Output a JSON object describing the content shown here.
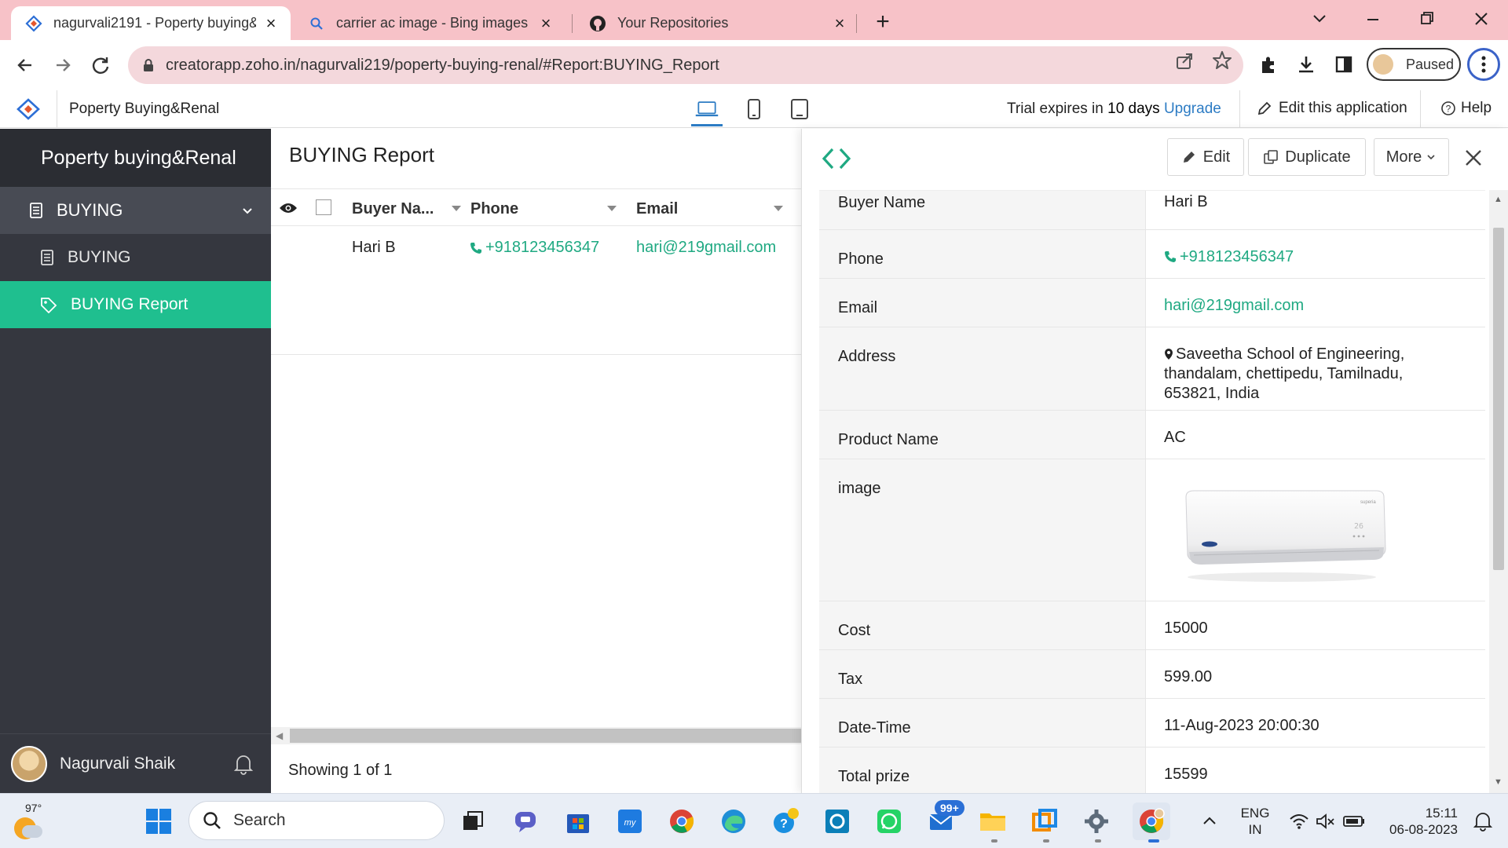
{
  "browser": {
    "tabs": [
      {
        "title": "nagurvali2191 - Poperty buying&",
        "active": true
      },
      {
        "title": "carrier ac image - Bing images",
        "active": false
      },
      {
        "title": "Your Repositories",
        "active": false
      }
    ],
    "url": "creatorapp.zoho.in/nagurvali219/poperty-buying-renal/#Report:BUYING_Report",
    "profile_label": "Paused"
  },
  "app_header": {
    "app_name": "Poperty Buying&Renal",
    "trial_prefix": "Trial expires in",
    "trial_days": "10 days",
    "upgrade": "Upgrade",
    "edit_app": "Edit this application",
    "help": "Help"
  },
  "sidebar": {
    "title": "Poperty buying&Renal",
    "group": "BUYING",
    "items": [
      {
        "label": "BUYING",
        "active": false
      },
      {
        "label": "BUYING Report",
        "active": true
      }
    ],
    "user_name": "Nagurvali Shaik"
  },
  "report": {
    "title": "BUYING Report",
    "columns": [
      "Buyer Na...",
      "Phone",
      "Email"
    ],
    "rows": [
      {
        "buyer": "Hari B",
        "phone": "+918123456347",
        "email": "hari@219gmail.com"
      }
    ],
    "footer_prefix": "Showing",
    "footer_count": "1",
    "footer_of": "of",
    "footer_total": "1"
  },
  "detail": {
    "buttons": {
      "edit": "Edit",
      "duplicate": "Duplicate",
      "more": "More"
    },
    "fields": [
      {
        "key": "Buyer Name",
        "value": "Hari B"
      },
      {
        "key": "Phone",
        "value": "+918123456347"
      },
      {
        "key": "Email",
        "value": "hari@219gmail.com"
      },
      {
        "key": "Address",
        "value_lines": [
          "Saveetha School of Engineering,",
          "thandalam, chettipedu, Tamilnadu,",
          "653821, India"
        ]
      },
      {
        "key": "Product Name",
        "value": "AC"
      },
      {
        "key": "image",
        "value": ""
      },
      {
        "key": "Cost",
        "value": "15000"
      },
      {
        "key": "Tax",
        "value": "599.00"
      },
      {
        "key": "Date-Time",
        "value": "11-Aug-2023 20:00:30"
      },
      {
        "key": "Total prize",
        "value": "15599"
      }
    ],
    "image_brand_text": "superia",
    "image_display_text": "26"
  },
  "taskbar": {
    "temperature": "97°",
    "search_placeholder": "Search",
    "badge": "99+",
    "lang_top": "ENG",
    "lang_bottom": "IN",
    "time": "15:11",
    "date": "06-08-2023"
  },
  "colors": {
    "accent_green": "#1fbf8f",
    "link_green": "#1fa982",
    "sidebar_bg": "#35373f",
    "tabbar_pink": "#f7c2c8",
    "upgrade_blue": "#2d7cc4"
  }
}
